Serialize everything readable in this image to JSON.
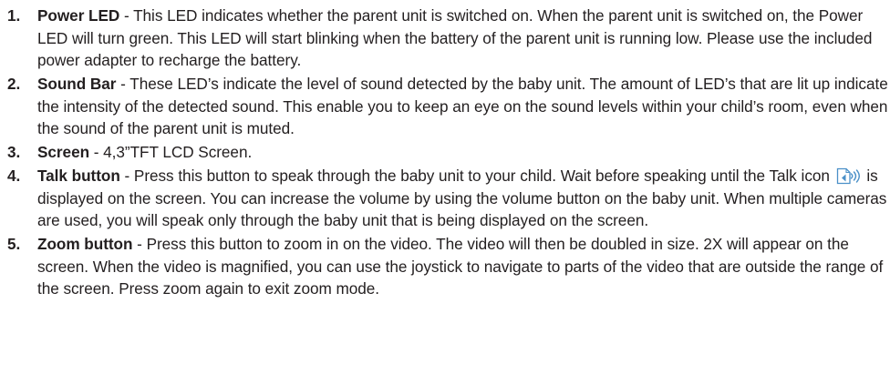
{
  "items": [
    {
      "number": "1.",
      "term": "Power LED",
      "text": " - This LED indicates whether the parent unit is switched on. When the parent unit is switched on, the Power LED will turn green. This LED will start blinking when the battery of the parent unit is running low. Please use the included power adapter to recharge the battery."
    },
    {
      "number": "2.",
      "term": "Sound Bar",
      "text": " - These LED’s indicate the level of sound detected by the baby unit. The amount of LED’s that are lit up indicate the intensity of the detected sound. This enable you to keep an eye on the sound levels within your child’s room, even when the sound of the parent unit is muted."
    },
    {
      "number": "3.",
      "term": "Screen",
      "text": " - 4,3”TFT LCD Screen."
    },
    {
      "number": "4.",
      "term": "Talk button",
      "text_before_icon": " - Press this button to speak through the baby unit to your child. Wait before speaking until the Talk icon ",
      "icon": "talk-icon",
      "text_after_icon": " is displayed on the screen. You can increase the volume by using the volume button on the baby unit. When multiple cameras are used, you will speak only through the baby unit that is being displayed on the screen."
    },
    {
      "number": "5.",
      "term": "Zoom button",
      "text": " - Press this button to zoom in on the video. The video will then be doubled in size. 2X will appear on the screen. When the video is magnified, you can use the joystick to navigate to parts of the video that are outside the range of the screen. Press zoom again to exit zoom mode."
    }
  ],
  "colors": {
    "text": "#231f20",
    "icon": "#4a90c8"
  }
}
